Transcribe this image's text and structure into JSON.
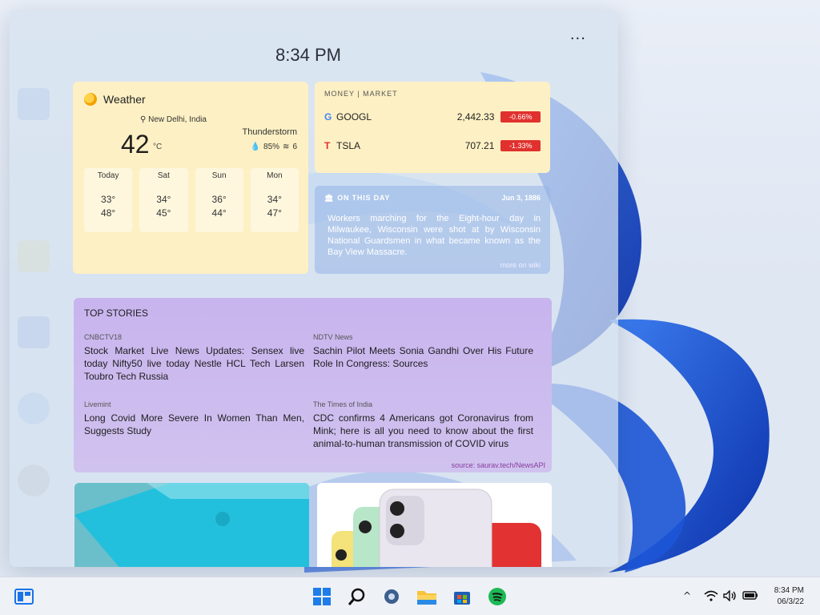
{
  "panel": {
    "time": "8:34 PM",
    "menu_icon": "more-horizontal-icon"
  },
  "weather": {
    "title": "Weather",
    "icon": "sun-cloud-icon",
    "location": "New Delhi, India",
    "temperature": "42",
    "unit": "°C",
    "condition": "Thunderstorm",
    "humidity": "85%",
    "wind": "6",
    "forecast": [
      {
        "day": "Today",
        "high": "33°",
        "low": "48°"
      },
      {
        "day": "Sat",
        "high": "34°",
        "low": "45°"
      },
      {
        "day": "Sun",
        "high": "36°",
        "low": "44°"
      },
      {
        "day": "Mon",
        "high": "34°",
        "low": "47°"
      }
    ]
  },
  "market": {
    "title": "MONEY | MARKET",
    "stocks": [
      {
        "symbol": "GOOGL",
        "price": "2,442.33",
        "change": "-0.66%",
        "color": "#e0312e"
      },
      {
        "symbol": "TSLA",
        "price": "707.21",
        "change": "-1.33%",
        "color": "#e0312e"
      }
    ]
  },
  "on_this_day": {
    "title": "ON THIS DAY",
    "date": "Jun 3, 1886",
    "text": "Workers marching for the Eight-hour day in Milwaukee, Wisconsin were shot at by Wisconsin National Guardsmen in what became known as the Bay View Massacre.",
    "more": "more on wiki"
  },
  "top_stories": {
    "title": "TOP STORIES",
    "items": [
      {
        "source": "CNBCTV18",
        "headline": "Stock Market Live News Updates: Sensex live today Nifty50 live today Nestle HCL Tech Larsen Toubro Tech Russia"
      },
      {
        "source": "NDTV News",
        "headline": "Sachin Pilot Meets Sonia Gandhi Over His Future Role In Congress: Sources"
      },
      {
        "source": "Livemint",
        "headline": "Long Covid More Severe In Women Than Men, Suggests Study"
      },
      {
        "source": "The Times of India",
        "headline": "CDC confirms 4 Americans got Coronavirus from Mink; here is all you need to know about the first animal-to-human transmission of COVID virus"
      }
    ],
    "footer": "source: saurav.tech/NewsAPI"
  },
  "taskbar": {
    "widgets_icon": "widgets-icon",
    "pinned": [
      "windows-start-icon",
      "search-icon",
      "settings-icon",
      "file-explorer-icon",
      "microsoft-store-icon",
      "spotify-icon"
    ],
    "clock_time": "8:34 PM",
    "clock_date": "06/3/22"
  }
}
